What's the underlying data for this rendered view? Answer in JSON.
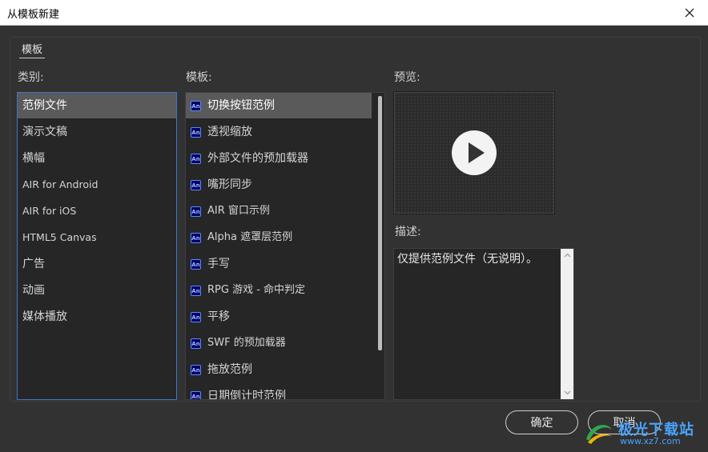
{
  "window": {
    "title": "从模板新建"
  },
  "tabs": [
    {
      "label": "模板"
    }
  ],
  "category": {
    "label": "类别:",
    "items": [
      {
        "label": "范例文件",
        "selected": true
      },
      {
        "label": "演示文稿"
      },
      {
        "label": "横幅"
      },
      {
        "label": "AIR for Android"
      },
      {
        "label": "AIR for iOS"
      },
      {
        "label": "HTML5 Canvas"
      },
      {
        "label": "广告"
      },
      {
        "label": "动画"
      },
      {
        "label": "媒体播放"
      }
    ]
  },
  "template": {
    "label": "模板:",
    "icon_text": "An",
    "items": [
      {
        "label": "切换按钮范例",
        "selected": true
      },
      {
        "label": "透视缩放"
      },
      {
        "label": "外部文件的预加载器"
      },
      {
        "label": "嘴形同步"
      },
      {
        "label": "AIR 窗口示例"
      },
      {
        "label": "Alpha 遮罩层范例"
      },
      {
        "label": "手写"
      },
      {
        "label": "RPG 游戏 - 命中判定"
      },
      {
        "label": "平移"
      },
      {
        "label": "SWF 的预加载器"
      },
      {
        "label": "拖放范例"
      },
      {
        "label": "日期倒计时范例"
      }
    ]
  },
  "preview": {
    "label": "预览:"
  },
  "description": {
    "label": "描述:",
    "text": "仅提供范例文件（无说明）。"
  },
  "buttons": {
    "ok": "确定",
    "cancel": "取消"
  },
  "watermark": {
    "line1": "极光下载站",
    "line2": "www.xz7.com"
  },
  "colors": {
    "accent": "#3c78c8",
    "background": "#323232",
    "panel": "#262626",
    "selected": "#5a5a5a"
  }
}
